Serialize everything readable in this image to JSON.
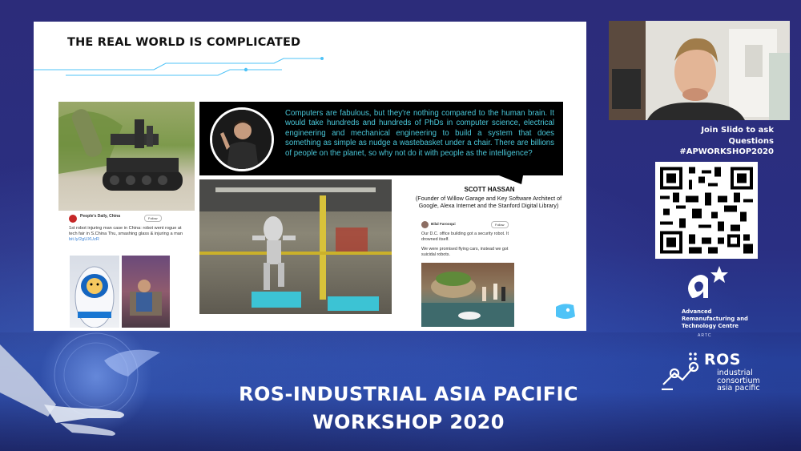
{
  "slide": {
    "title": "THE REAL WORLD IS COMPLICATED",
    "tweet1": {
      "account": "People's Daily, China",
      "follow_label": "Follow",
      "text": "1st robot injuring man case in China: robot went rogue at tech fair in S.China Thu, smashing glass & injuring a man",
      "link": "bit.ly/2gUXUzR"
    },
    "quote": {
      "text": "Computers are fabulous, but they're nothing compared to the human brain. It would take hundreds and hundreds of PhDs in computer science, electrical engineering and mechanical engineering to build a system that does something as simple as nudge a wastebasket under a chair. There are billions of people on the planet, so why not do it with people as the intelligence?",
      "speaker": "SCOTT HASSAN",
      "speaker_desc": "(Founder of Willow Garage and Key Software Architect of Google, Alexa Internet and the Stanford Digital Library)"
    },
    "tweet2": {
      "account": "Bilal Farooqui",
      "follow_label": "Follow",
      "line1": "Our D.C. office building got a security robot. It drowned itself.",
      "line2": "We were promised flying cars, instead we got suicidal robots."
    }
  },
  "sidebar": {
    "slido_line1": "Join Slido to ask",
    "slido_line2": "Questions",
    "hashtag": "#APWORKSHOP2020",
    "artc_line1": "Advanced",
    "artc_line2": "Remanufacturing and",
    "artc_line3": "Technology Centre",
    "artc_abbr": "ARTC",
    "ros_word": "ROS",
    "ros_line1": "industrial",
    "ros_line2": "consortium",
    "ros_line3": "asia pacific"
  },
  "footer": {
    "title_line1": "ROS-INDUSTRIAL ASIA PACIFIC",
    "title_line2": "WORKSHOP 2020"
  },
  "colors": {
    "background": "#2a2a78",
    "quote_text": "#48c6d8",
    "slide_bg": "#ffffff",
    "accent_cyan": "#4fc3f7"
  }
}
